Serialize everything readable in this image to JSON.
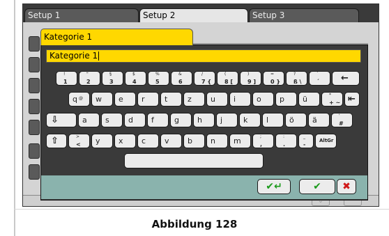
{
  "tabs": [
    {
      "label": "Setup 1",
      "active": false
    },
    {
      "label": "Setup 2",
      "active": true
    },
    {
      "label": "Setup 3",
      "active": false
    }
  ],
  "dialog": {
    "tab_label": "Kategorie 1",
    "input_value": "Kategorie 1"
  },
  "keyboard": {
    "row1": [
      {
        "up": "!",
        "dn": "1"
      },
      {
        "up": "\"",
        "dn": "2"
      },
      {
        "up": "§",
        "dn": "3"
      },
      {
        "up": "$",
        "dn": "4"
      },
      {
        "up": "%",
        "dn": "5"
      },
      {
        "up": "&",
        "dn": "6"
      },
      {
        "up": "/",
        "dn": "7 {"
      },
      {
        "up": "(",
        "dn": "8 ["
      },
      {
        "up": ")",
        "dn": "9 ]"
      },
      {
        "up": "=",
        "dn": "0 }"
      },
      {
        "up": "?",
        "dn": "ß \\"
      },
      {
        "up": "`",
        "dn": "´"
      }
    ],
    "backspace": "←",
    "row2": [
      {
        "main": "q",
        "sm": "@"
      },
      {
        "main": "w"
      },
      {
        "main": "e"
      },
      {
        "main": "r"
      },
      {
        "main": "t"
      },
      {
        "main": "z"
      },
      {
        "main": "u"
      },
      {
        "main": "i"
      },
      {
        "main": "o"
      },
      {
        "main": "p"
      },
      {
        "main": "ü"
      },
      {
        "up": "*",
        "dn": "+ ~"
      }
    ],
    "back_tab": "⇤",
    "row3_left": "⇩",
    "row3": [
      {
        "main": "a"
      },
      {
        "main": "s"
      },
      {
        "main": "d"
      },
      {
        "main": "f"
      },
      {
        "main": "g"
      },
      {
        "main": "h"
      },
      {
        "main": "j"
      },
      {
        "main": "k"
      },
      {
        "main": "l"
      },
      {
        "main": "ö"
      },
      {
        "main": "ä"
      },
      {
        "up": "'",
        "dn": "#"
      }
    ],
    "shift": "⇧",
    "row4": [
      {
        "up": ">",
        "dn": "<"
      },
      {
        "main": "y"
      },
      {
        "main": "x"
      },
      {
        "main": "c"
      },
      {
        "main": "v"
      },
      {
        "main": "b"
      },
      {
        "main": "n"
      },
      {
        "main": "m"
      },
      {
        "up": ";",
        "dn": ","
      },
      {
        "up": ":",
        "dn": "."
      },
      {
        "up": "_",
        "dn": "-"
      }
    ],
    "altgr": "AltGr"
  },
  "buttons": {
    "enter_glyph": "✔↵",
    "ok_glyph": "✔",
    "cancel_glyph": "✖"
  },
  "background": {
    "chevron_down": "⌄",
    "chevron_up": "⌃"
  },
  "colors": {
    "accent_yellow": "#ffd800",
    "status_bar": "#8ab3ad",
    "ok_green": "#1a9a1a",
    "cancel_red": "#d01818"
  },
  "caption": "Abbildung 128"
}
